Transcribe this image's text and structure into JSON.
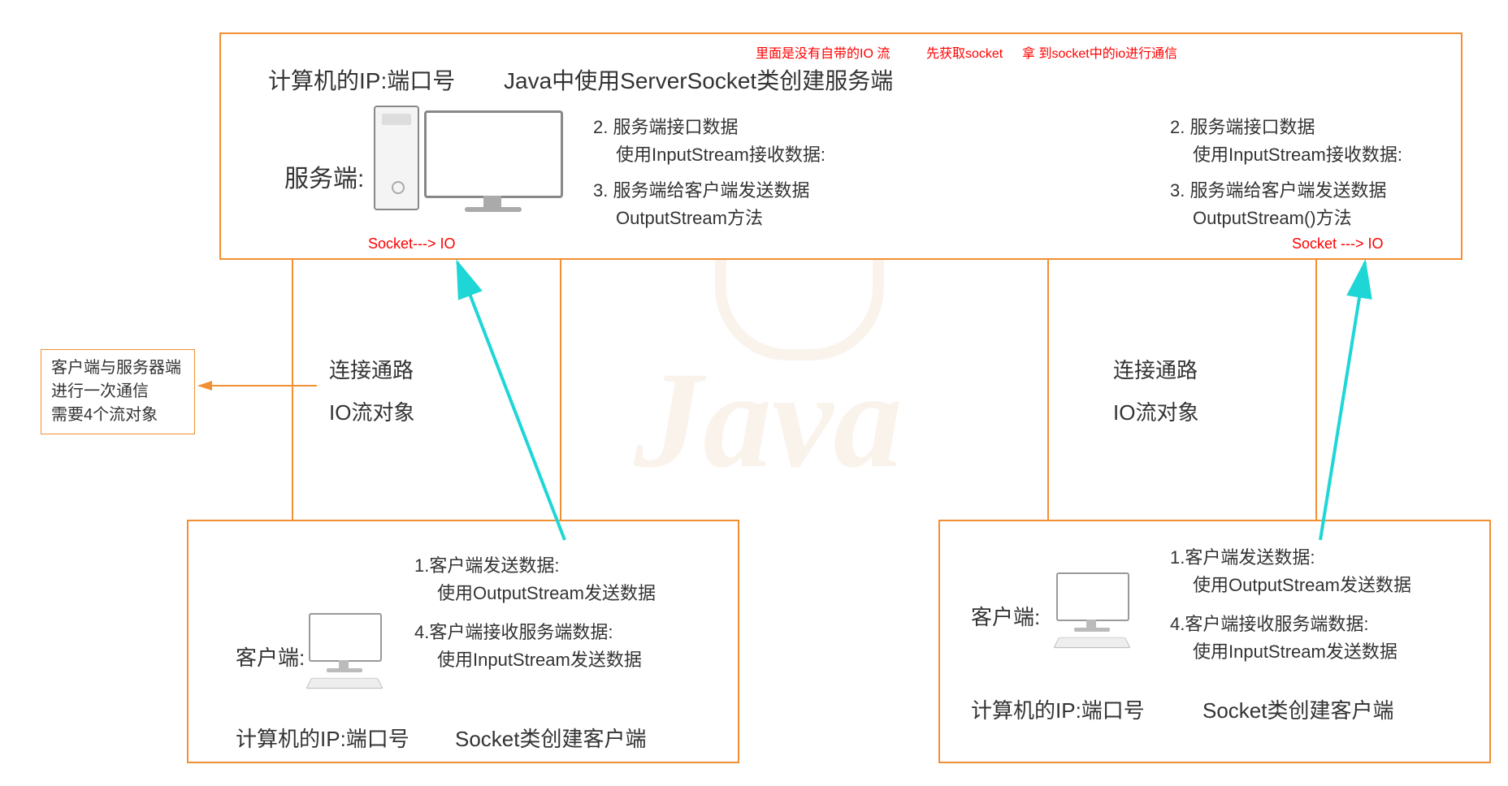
{
  "server": {
    "title_left": "计算机的IP:端口号",
    "title_right": "Java中使用ServerSocket类创建服务端",
    "top_note_1": "里面是没有自带的IO 流",
    "top_note_2": "先获取socket",
    "top_note_3": "拿 到socket中的io进行通信",
    "label": "服务端:",
    "steps_left": {
      "s2a": "2. 服务端接口数据",
      "s2b": "使用InputStream接收数据:",
      "s3a": "3. 服务端给客户端发送数据",
      "s3b": "OutputStream方法"
    },
    "steps_right": {
      "s2a": "2. 服务端接口数据",
      "s2b": "使用InputStream接收数据:",
      "s3a": "3. 服务端给客户端发送数据",
      "s3b": "OutputStream()方法"
    },
    "socket_io_left": "Socket---> IO",
    "socket_io_right": "Socket ---> IO"
  },
  "side_note": {
    "l1": "客户端与服务器端",
    "l2": "进行一次通信",
    "l3": "需要4个流对象"
  },
  "channel": {
    "l1": "连接通路",
    "l2": "IO流对象"
  },
  "client_a": {
    "label": "客户端:",
    "s1a": "1.客户端发送数据:",
    "s1b": "使用OutputStream发送数据",
    "s4a": "4.客户端接收服务端数据:",
    "s4b": "使用InputStream发送数据",
    "foot_left": "计算机的IP:端口号",
    "foot_right": "Socket类创建客户端"
  },
  "client_b": {
    "label": "客户端:",
    "s1a": "1.客户端发送数据:",
    "s1b": "使用OutputStream发送数据",
    "s4a": "4.客户端接收服务端数据:",
    "s4b": "使用InputStream发送数据",
    "foot_left": "计算机的IP:端口号",
    "foot_right": "Socket类创建客户端"
  }
}
